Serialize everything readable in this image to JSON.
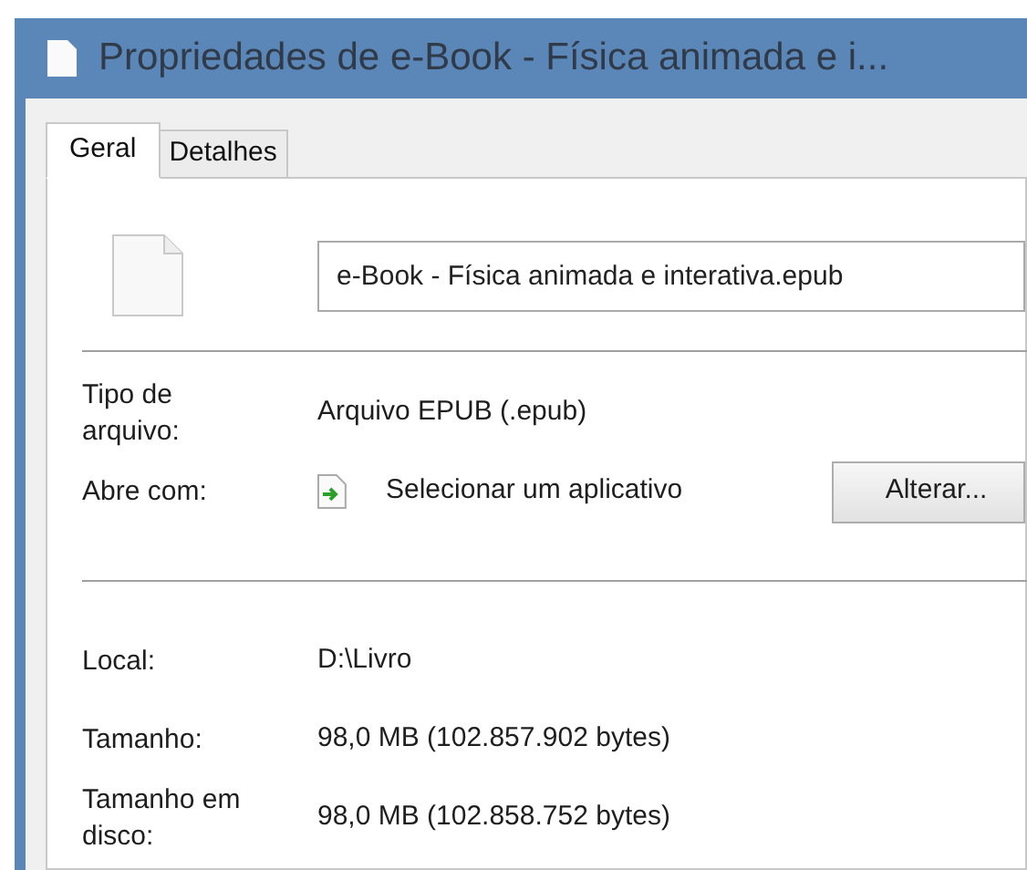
{
  "window": {
    "title": "Propriedades de e-Book - Física animada e i..."
  },
  "tabs": [
    {
      "label": "Geral",
      "selected": true
    },
    {
      "label": "Detalhes",
      "selected": false
    }
  ],
  "file_name": {
    "value": "e-Book - Física animada e interativa.epub"
  },
  "properties": [
    {
      "kind": "text",
      "label": "Tipo de arquivo:",
      "value": "Arquivo EPUB (.epub)"
    },
    {
      "kind": "app",
      "label": "Abre com:",
      "value": "Selecionar um aplicativo",
      "button": "Alterar..."
    },
    {
      "kind": "divider"
    },
    {
      "kind": "text",
      "label": "Local:",
      "value": "D:\\Livro"
    },
    {
      "kind": "text",
      "label": "Tamanho:",
      "value": "98,0 MB (102.857.902 bytes)"
    },
    {
      "kind": "text",
      "label": "Tamanho em disco:",
      "value": "98,0 MB (102.858.752 bytes)"
    }
  ]
}
